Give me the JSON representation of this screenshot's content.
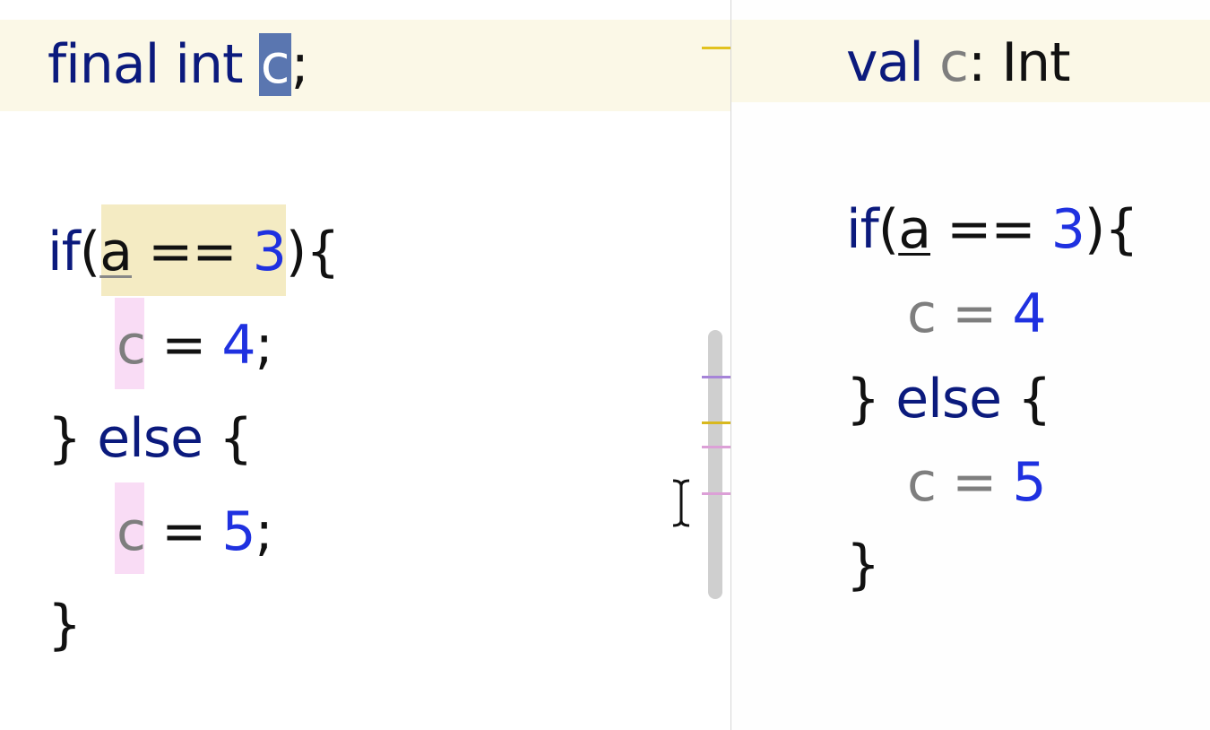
{
  "left_editor": {
    "language": "Java",
    "lines": {
      "decl": {
        "kw": "final int ",
        "var": "c",
        "punct": ";"
      },
      "if_line": {
        "kw": "if",
        "open": "(",
        "var": "a",
        "op": " == ",
        "num": "3",
        "close": "){"
      },
      "assign1": {
        "var": "c",
        "op": " = ",
        "num": "4",
        "punct": ";"
      },
      "else_line": {
        "brace": "} ",
        "kw": "else",
        "open": " {"
      },
      "assign2": {
        "var": "c",
        "op": " = ",
        "num": "5",
        "punct": ";"
      },
      "end": {
        "brace": "}"
      }
    }
  },
  "right_editor": {
    "language": "Kotlin",
    "lines": {
      "decl": {
        "kw": "val ",
        "var": "c",
        "colon": ": ",
        "type": "Int"
      },
      "if_line": {
        "kw": "if",
        "open": "(",
        "var": "a",
        "op": " == ",
        "num": "3",
        "close": "){"
      },
      "assign1": {
        "var": "c",
        "op": " = ",
        "num": "4"
      },
      "else_line": {
        "brace": "} ",
        "kw": "else",
        "open": " {"
      },
      "assign2": {
        "var": "c",
        "op": " = ",
        "num": "5"
      },
      "end": {
        "brace": "}"
      }
    }
  },
  "colors": {
    "keyword": "#0b1a7d",
    "variable": "#7e7e7e",
    "number": "#1f31e0",
    "selection": "#5a76b0",
    "line_highlight": "#fbf8e7",
    "condition_highlight": "#f4ebc3",
    "assignment_highlight": "#f9dcf5",
    "scrollbar": "#cfcfcf"
  },
  "icons": [
    "text-cursor-icon"
  ]
}
